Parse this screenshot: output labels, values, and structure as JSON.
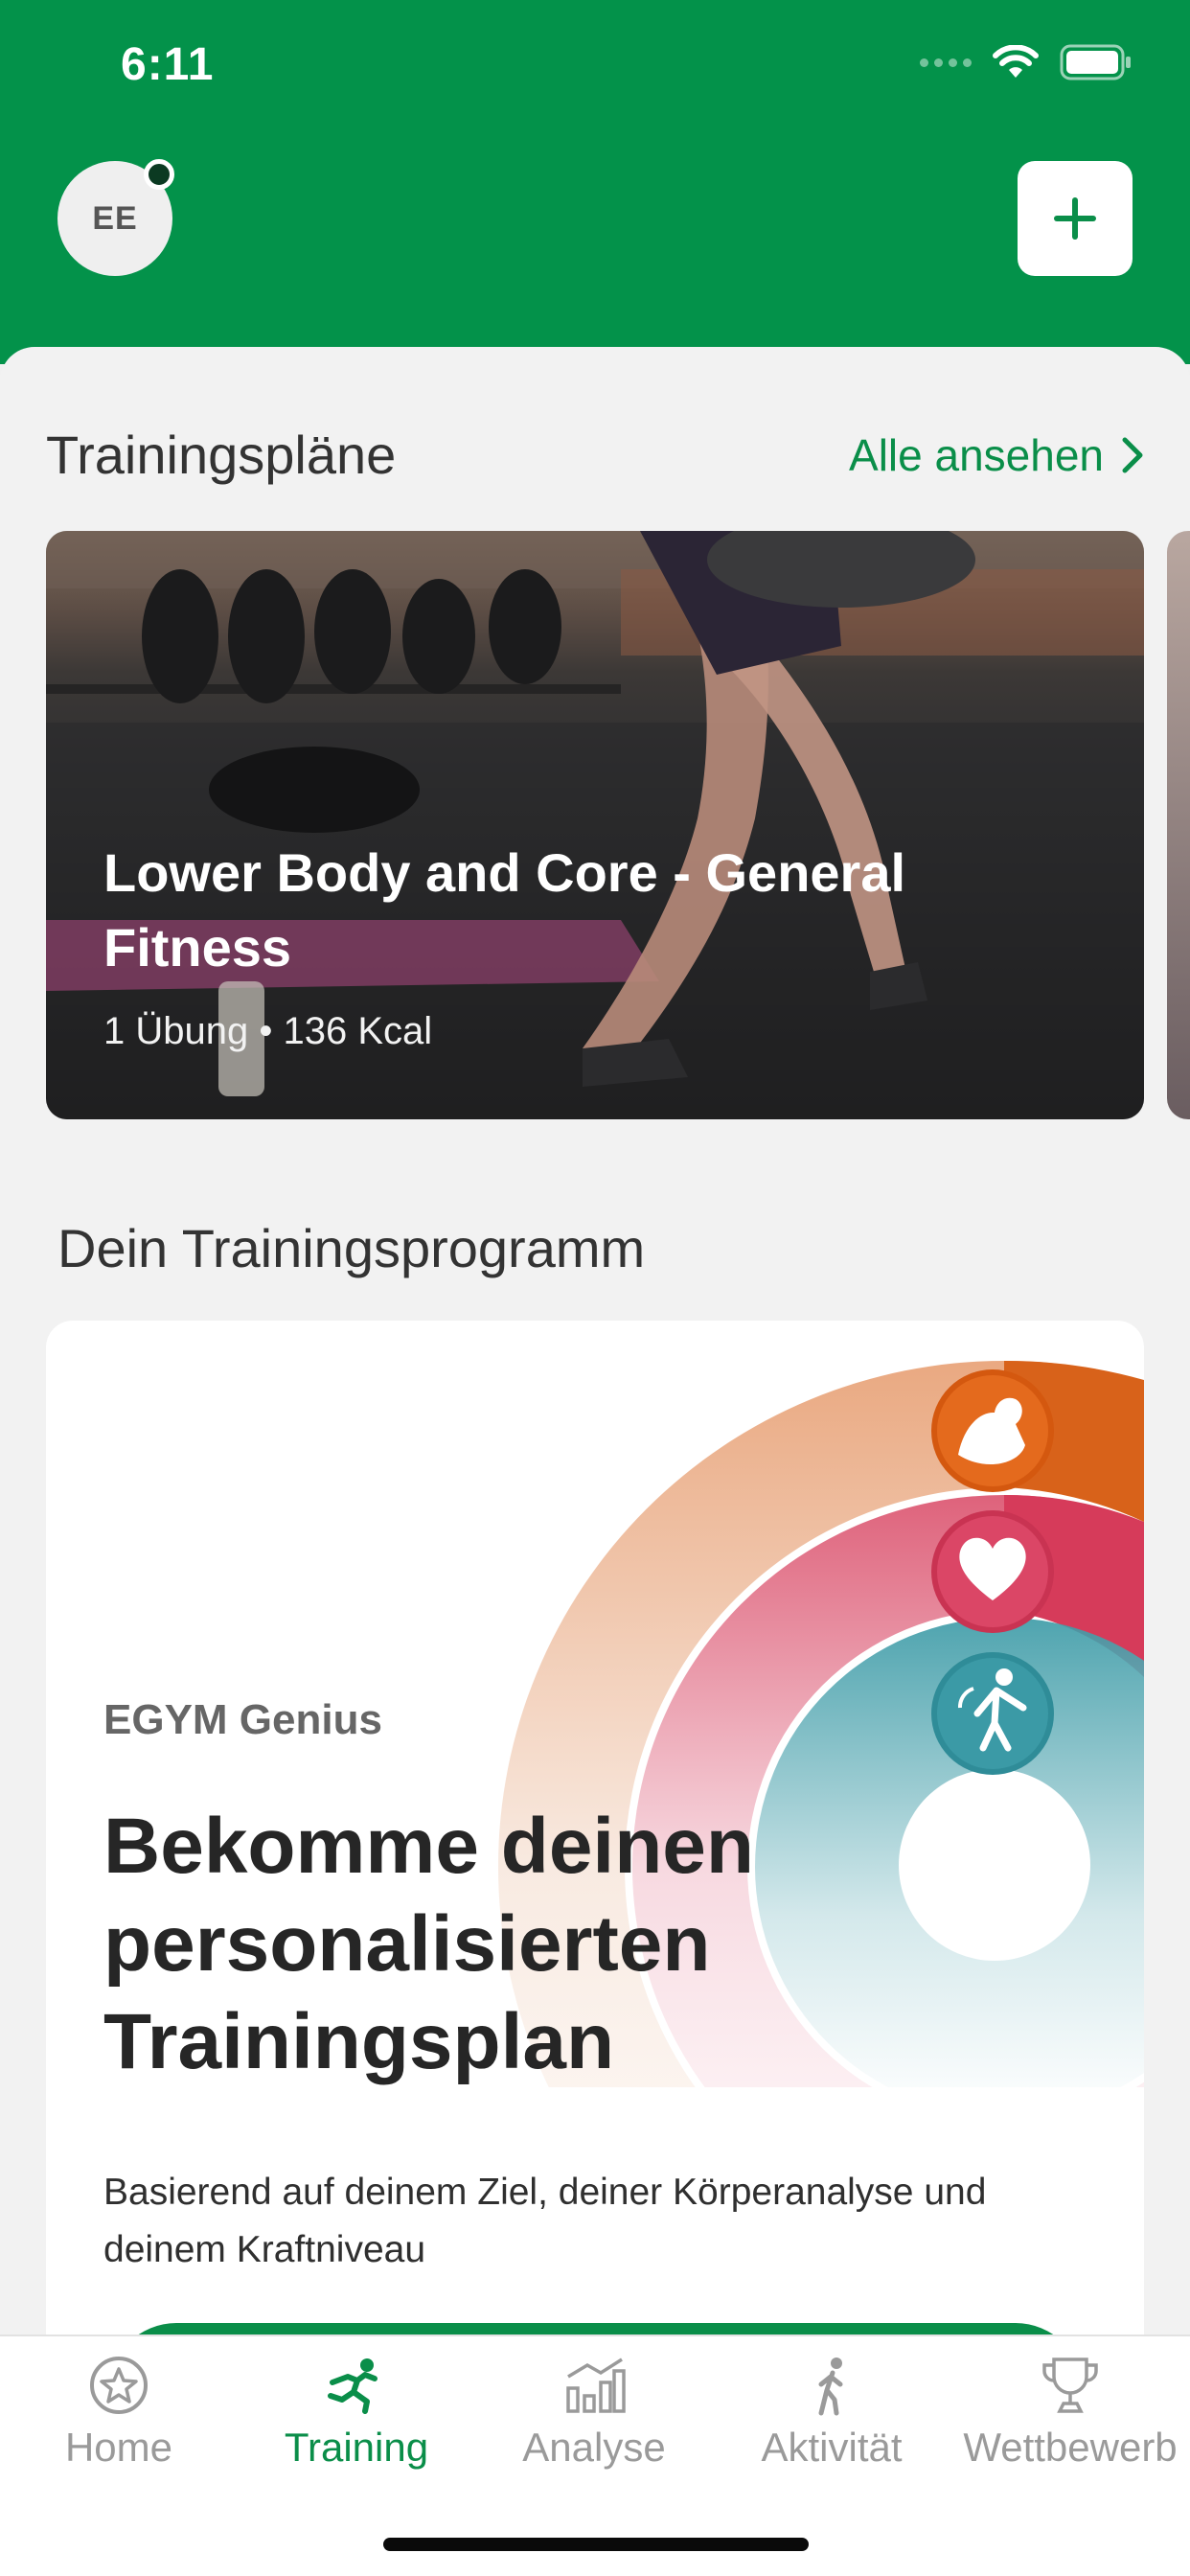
{
  "status_bar": {
    "time": "6:11"
  },
  "header": {
    "avatar_initials": "EE"
  },
  "training_plans": {
    "title": "Trainingspläne",
    "see_all": "Alle ansehen",
    "cards": [
      {
        "title": "Lower Body and Core - General Fitness",
        "meta": "1 Übung • 136 Kcal"
      }
    ]
  },
  "program": {
    "title": "Dein Trainingsprogramm",
    "card": {
      "label": "EGYM Genius",
      "headline": "Bekomme deinen personalisierten Trainingsplan",
      "description": "Basierend auf deinem Ziel, deiner Körperanalyse und deinem Kraftniveau"
    }
  },
  "tabs": [
    {
      "label": "Home",
      "icon": "star-circle-icon",
      "active": false
    },
    {
      "label": "Training",
      "icon": "running-icon",
      "active": true
    },
    {
      "label": "Analyse",
      "icon": "chart-icon",
      "active": false
    },
    {
      "label": "Aktivität",
      "icon": "walking-icon",
      "active": false
    },
    {
      "label": "Wettbewerb",
      "icon": "trophy-icon",
      "active": false
    }
  ],
  "colors": {
    "brand_green": "#03924a",
    "accent_green": "#0a8e49",
    "strength_orange": "#e0651b",
    "cardio_red": "#d83a5b",
    "flex_teal": "#3a9aa6"
  }
}
